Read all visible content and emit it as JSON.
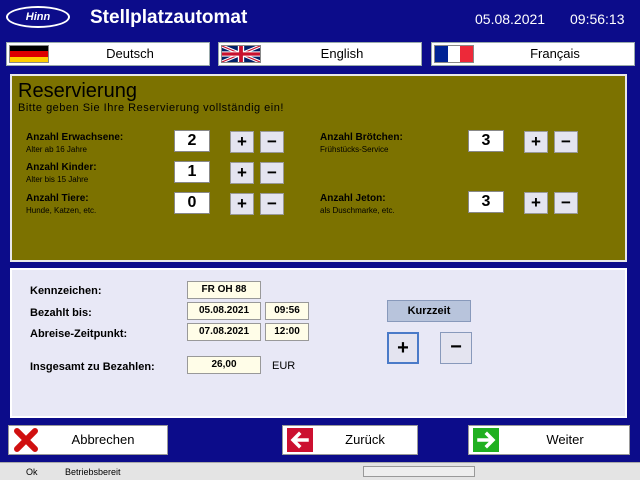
{
  "header": {
    "logo_text": "Hinn",
    "title": "Stellplatzautomat",
    "date": "05.08.2021",
    "time": "09:56:13"
  },
  "languages": [
    {
      "label": "Deutsch",
      "flag": "germany-flag"
    },
    {
      "label": "English",
      "flag": "uk-flag"
    },
    {
      "label": "Français",
      "flag": "france-flag"
    }
  ],
  "reservation": {
    "title": "Reservierung",
    "subtitle": "Bitte geben Sie Ihre Reservierung vollständig ein!",
    "adults": {
      "label": "Anzahl Erwachsene:",
      "sub": "Alter ab 16 Jahre",
      "value": "2"
    },
    "children": {
      "label": "Anzahl Kinder:",
      "sub": "Alter bis 15 Jahre",
      "value": "1"
    },
    "animals": {
      "label": "Anzahl Tiere:",
      "sub": "Hunde, Katzen, etc.",
      "value": "0"
    },
    "rolls": {
      "label": "Anzahl Brötchen:",
      "sub": "Frühstücks-Service",
      "value": "3"
    },
    "tokens": {
      "label": "Anzahl Jeton:",
      "sub": "als Duschmarke, etc.",
      "value": "3"
    },
    "plus": "+",
    "minus": "−"
  },
  "booking": {
    "plate_label": "Kennzeichen:",
    "plate_value": "FR OH 88",
    "paid_label": "Bezahlt bis:",
    "paid_date": "05.08.2021",
    "paid_time": "09:56",
    "departure_label": "Abreise-Zeitpunkt:",
    "departure_date": "07.08.2021",
    "departure_time": "12:00",
    "total_label": "Insgesamt zu Bezahlen:",
    "total_value": "26,00",
    "currency": "EUR",
    "kurzzeit_label": "Kurzzeit",
    "plus": "+",
    "minus": "−"
  },
  "footer": {
    "cancel_label": "Abbrechen",
    "back_label": "Zurück",
    "next_label": "Weiter"
  },
  "status": {
    "code": "Ok",
    "text": "Betriebsbereit"
  },
  "colors": {
    "background": "#0c0c8a",
    "olive_panel": "#7c7200",
    "light_panel": "#e8e8f6",
    "cancel_red": "#d01010",
    "back_red": "#cc1030",
    "next_green": "#20b020"
  }
}
